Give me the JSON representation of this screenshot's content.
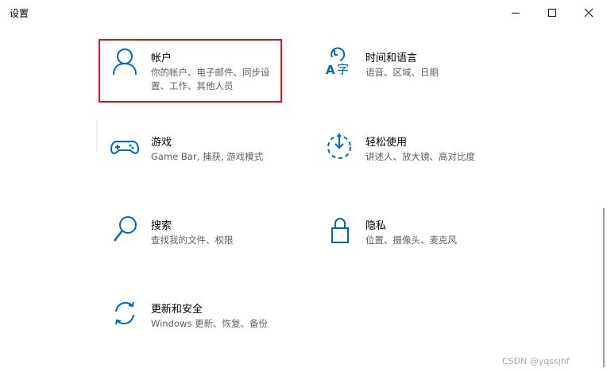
{
  "window": {
    "title": "设置",
    "controls": {
      "minimize_icon": "minimize-icon",
      "maximize_icon": "maximize-icon",
      "close_icon": "close-icon"
    }
  },
  "colors": {
    "accent": "#0067c0",
    "highlight_border": "#e0161c",
    "description_text": "#5f5f5f"
  },
  "settings": {
    "accounts": {
      "title": "帐户",
      "description": "你的帐户、电子邮件、同步设置、工作、其他人员",
      "icon": "person-icon"
    },
    "time_language": {
      "title": "时间和语言",
      "description": "语音、区域、日期",
      "icon": "time-language-icon"
    },
    "gaming": {
      "title": "游戏",
      "description": "Game Bar, 捕获, 游戏模式",
      "icon": "gamepad-icon"
    },
    "ease_of_access": {
      "title": "轻松使用",
      "description": "讲述人、放大镜、高对比度",
      "icon": "ease-of-access-icon"
    },
    "search": {
      "title": "搜索",
      "description": "查找我的文件、权限",
      "icon": "search-icon"
    },
    "privacy": {
      "title": "隐私",
      "description": "位置、摄像头、麦克风",
      "icon": "lock-icon"
    },
    "update_security": {
      "title": "更新和安全",
      "description": "Windows 更新、恢复、备份",
      "icon": "sync-icon"
    }
  },
  "watermark": "CSDN @yqssjhf"
}
